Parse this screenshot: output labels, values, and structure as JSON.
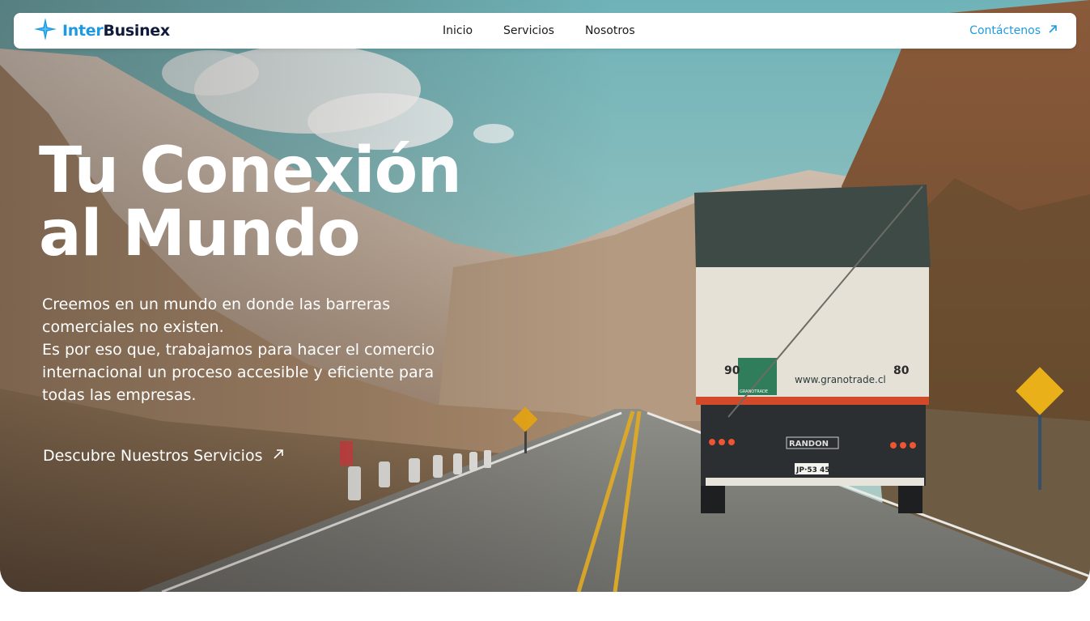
{
  "brand": {
    "part1": "Inter",
    "part2": "Businex"
  },
  "nav": {
    "links": [
      "Inicio",
      "Servicios",
      "Nosotros"
    ],
    "contact_label": "Contáctenos"
  },
  "hero": {
    "title_line1": "Tu Conexión",
    "title_line2": "al Mundo",
    "description": [
      "Creemos en un mundo en donde las barreras",
      "comerciales no existen.",
      "Es por eso que, trabajamos para hacer el comercio",
      "internacional un proceso accesible y eficiente para",
      "todas las empresas."
    ],
    "cta_label": "Descubre Nuestros Servicios"
  },
  "truck": {
    "left_number": "90",
    "right_number": "80",
    "website": "www.granotrade.cl",
    "brand_badge": "GRANOTRADE",
    "bumper_brand": "RANDON",
    "plate": "JP·53 45"
  },
  "colors": {
    "accent": "#1e9be0",
    "brand_dark": "#101b3c",
    "nav_bg": "#ffffff"
  },
  "icons": {
    "logo": "star-sparkle-icon",
    "arrow": "arrow-up-right-icon"
  }
}
